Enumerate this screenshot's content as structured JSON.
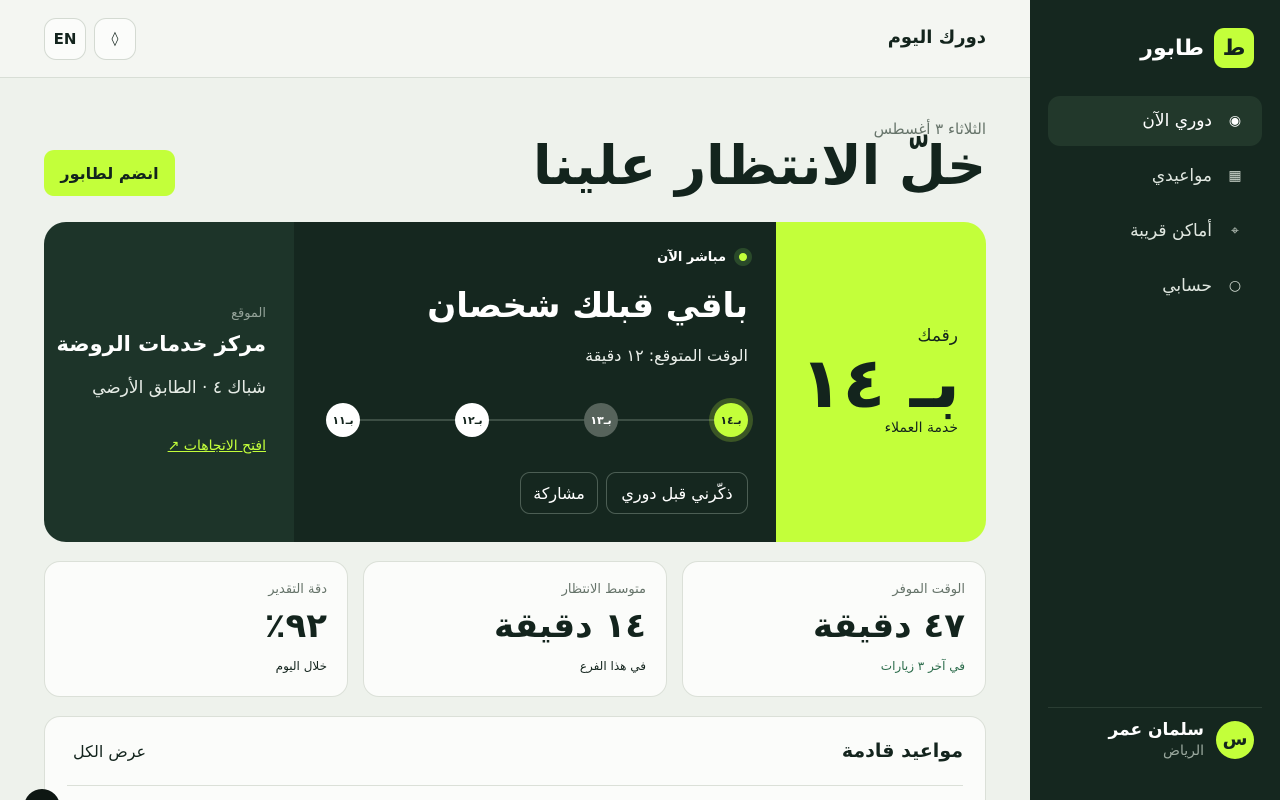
{
  "brand": {
    "name": "طابور",
    "logo_letter": "ط"
  },
  "nav": {
    "items": [
      {
        "label": "دوري الآن",
        "icon": "radio-icon",
        "glyph": "◉",
        "active": true
      },
      {
        "label": "مواعيدي",
        "icon": "calendar-grid-icon",
        "glyph": "▦",
        "active": false
      },
      {
        "label": "أماكن قريبة",
        "icon": "location-icon",
        "glyph": "⌖",
        "active": false
      },
      {
        "label": "حسابي",
        "icon": "account-icon",
        "glyph": "○",
        "active": false
      }
    ]
  },
  "user": {
    "initial": "س",
    "name": "سلمان عمر",
    "city": "الرياض"
  },
  "topbar": {
    "title": "دورك اليوم",
    "lang_label": "EN",
    "theme_glyph": "◊"
  },
  "hero": {
    "date": "الثلاثاء ٣ أغسطس",
    "title": "خلّ الانتظار علينا",
    "join_label": "انضم لطابور"
  },
  "ticket": {
    "number_label": "رقمك",
    "number": "بـ ١٤",
    "department": "خدمة العملاء",
    "live_label": "مباشر الآن",
    "headline": "باقي قبلك شخصان",
    "eta": "الوقت المتوقع: ١٢ دقيقة",
    "track": [
      {
        "label": "بـ١٤",
        "state": "current"
      },
      {
        "label": "بـ١٣",
        "state": "passed"
      },
      {
        "label": "بـ١٢",
        "state": "next"
      },
      {
        "label": "بـ١١",
        "state": "next"
      }
    ],
    "remind_label": "ذكّرني قبل دوري",
    "share_label": "مشاركة",
    "location_label": "الموقع",
    "location_name": "مركز خدمات الروضة",
    "location_detail": "شباك ٤ · الطابق الأرضي",
    "directions_label": "افتح الاتجاهات ↗"
  },
  "stats": [
    {
      "label": "الوقت الموفر",
      "value": "٤٧ دقيقة",
      "note": "في آخر ٣ زيارات"
    },
    {
      "label": "متوسط الانتظار",
      "value": "١٤ دقيقة",
      "note": "في هذا الفرع"
    },
    {
      "label": "دقة التقدير",
      "value": "٩٢٪",
      "note": "خلال اليوم"
    }
  ],
  "upcoming": {
    "title": "مواعيد قادمة",
    "view_all_label": "عرض الكل"
  },
  "colors": {
    "accent": "#c3ff3a",
    "dark": "#15271f",
    "background": "#eef2ec"
  }
}
